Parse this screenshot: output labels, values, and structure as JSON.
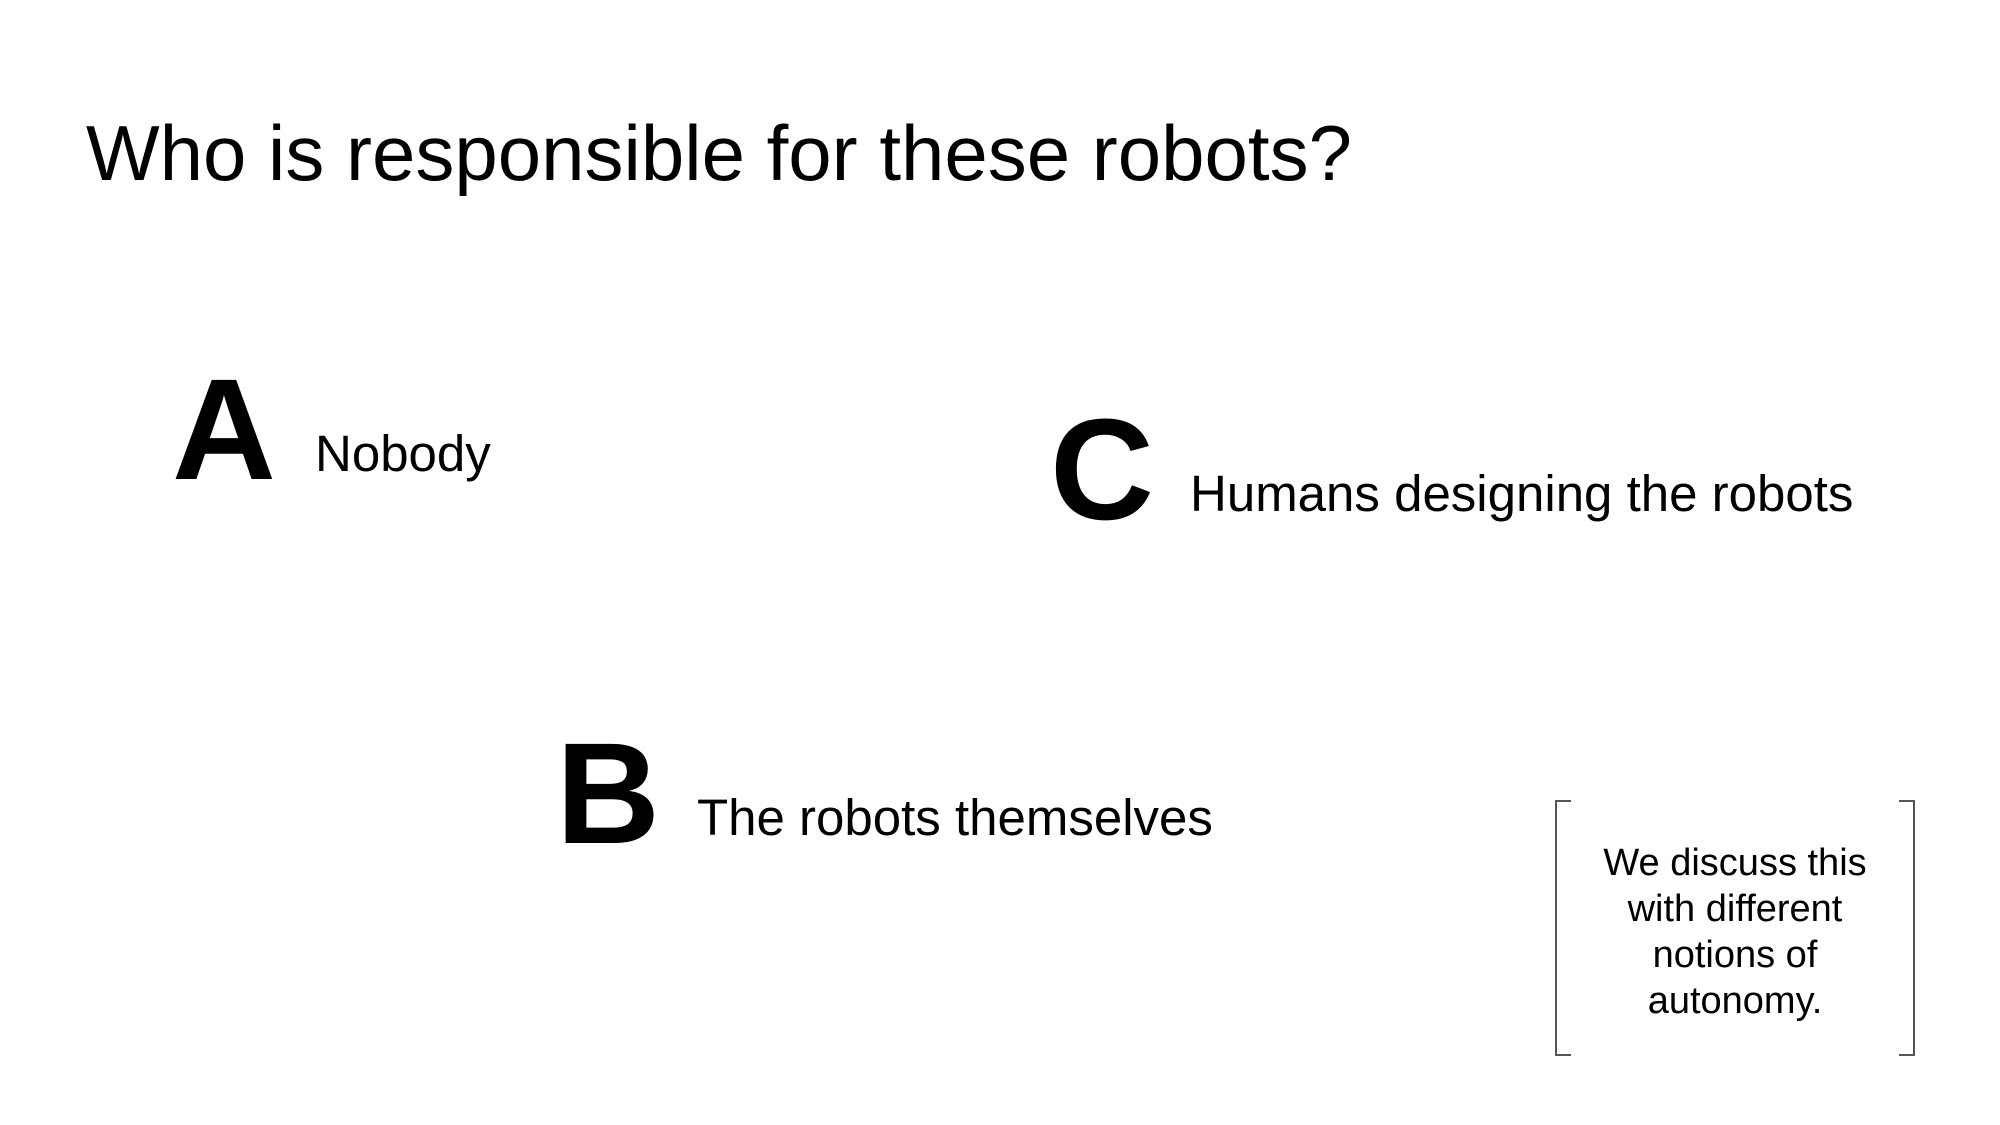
{
  "slide": {
    "title": "Who is responsible for these robots?",
    "options": {
      "a": {
        "letter": "A",
        "text": "Nobody"
      },
      "b": {
        "letter": "B",
        "text": "The robots themselves"
      },
      "c": {
        "letter": "C",
        "text": "Humans designing the robots"
      }
    },
    "note": {
      "lines": [
        "We discuss this",
        "with different",
        "notions of",
        "autonomy."
      ]
    }
  }
}
